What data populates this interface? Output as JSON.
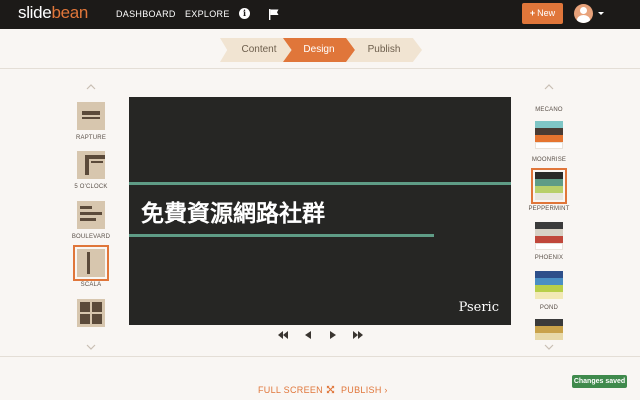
{
  "app": {
    "logo_main": "slide",
    "logo_accent": "bean"
  },
  "nav": {
    "dashboard": "DASHBOARD",
    "explore": "EXPLORE",
    "info_icon": "info-icon",
    "flag_icon": "flag-icon",
    "new_label": "New",
    "avatar_icon": "user-avatar"
  },
  "steps": [
    {
      "label": "Content"
    },
    {
      "label": "Design"
    },
    {
      "label": "Publish"
    }
  ],
  "layouts": [
    {
      "label": "RAPTURE"
    },
    {
      "label": "5 O'CLOCK"
    },
    {
      "label": "BOULEVARD"
    },
    {
      "label": "SCALA",
      "selected": true
    },
    {
      "label": ""
    }
  ],
  "slide": {
    "title": "免費資源網路社群",
    "brand": "Pseric"
  },
  "player": {
    "controls": [
      "rewind-icon",
      "prev-icon",
      "play-icon",
      "fast-forward-icon"
    ]
  },
  "themes": [
    {
      "label": "MECANO",
      "colors": [
        "#4a3b33",
        "#7fc6c6",
        "#c94a3a",
        "#e5742f",
        "#ffffff"
      ]
    },
    {
      "label": "MOONRISE",
      "colors": [
        "#2a2a28",
        "#5f9c86",
        "#b8cf6a",
        "#e8e6df",
        "#ffffff"
      ],
      "selected": true
    },
    {
      "label": "PEPPERMINT",
      "colors": [
        "#3b3b3b",
        "#d7d1c5",
        "#c0473a",
        "#ffffff",
        "#ffffff"
      ]
    },
    {
      "label": "PHOENIX",
      "colors": [
        "#2e4f8a",
        "#4a8fc4",
        "#b8cf4a",
        "#f2e9b5",
        "#ffffff"
      ]
    },
    {
      "label": "POND",
      "colors": [
        "#3a3a3a",
        "#c9a24a",
        "#e8d9a8",
        "#ffffff",
        "#ffffff"
      ]
    }
  ],
  "footer": {
    "full_screen": "FULL SCREEN",
    "publish": "PUBLISH ›",
    "saved": "Changes saved"
  },
  "colors": {
    "accent": "#e0763a",
    "topbar": "#1c1a18",
    "background": "#f9f6f3",
    "slide_bg": "#262624",
    "slide_rule": "#5f9c86",
    "saved_badge": "#3f8a4c"
  }
}
